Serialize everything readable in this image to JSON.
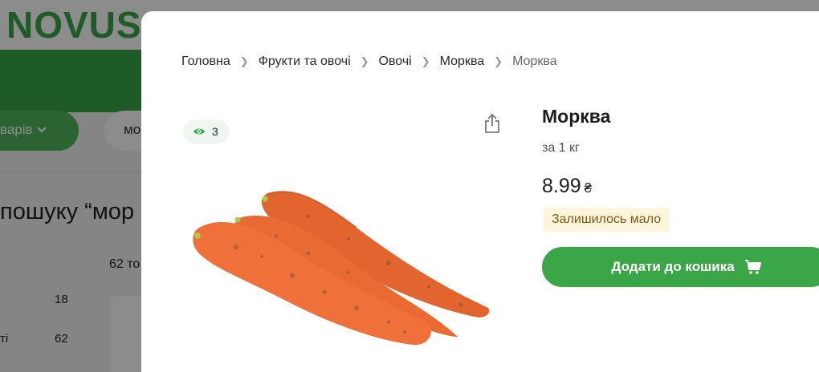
{
  "background": {
    "logo": "NOVUS",
    "catalog_button": "варів",
    "search_value": "мо",
    "results_title": "пошуку “мор",
    "results_count": "62 то",
    "filters": [
      {
        "label": "",
        "count": "18"
      },
      {
        "label": "ті",
        "count": "62"
      }
    ]
  },
  "breadcrumb": [
    "Головна",
    "Фрукти та овочі",
    "Овочі",
    "Морква",
    "Морква"
  ],
  "views": {
    "icon": "eye-icon",
    "count": "3"
  },
  "product": {
    "title": "Морква",
    "unit": "за 1 кг",
    "price": "8.99",
    "currency": "₴",
    "stock_status": "Залишилось мало",
    "add_to_cart_label": "Додати до кошика",
    "image": "carrots-photo"
  },
  "colors": {
    "brand_green": "#3aa647",
    "stock_badge_bg": "#fdf4dc",
    "views_badge_bg": "#eef6ef"
  }
}
